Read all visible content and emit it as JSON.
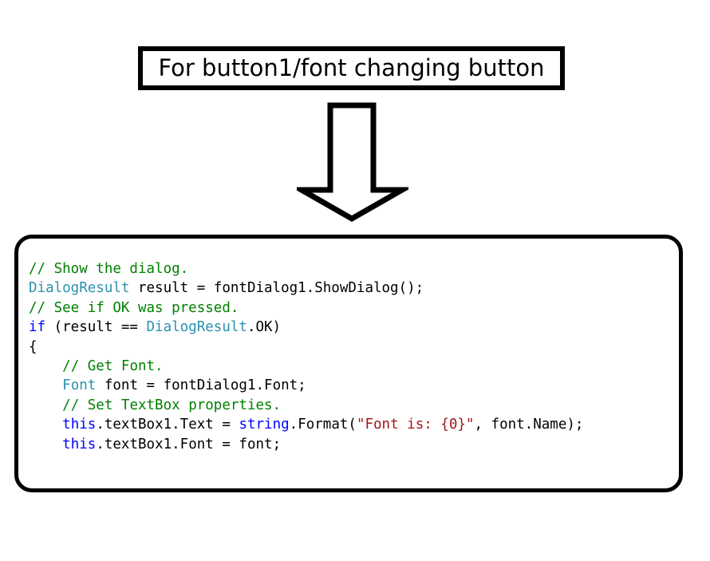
{
  "callout": {
    "title": "For button1/font changing button"
  },
  "arrow": {
    "icon": "down-arrow-icon",
    "direction": "down"
  },
  "code_panel": {
    "language": "csharp",
    "colors": {
      "comment": "#008000",
      "type": "#2B91AF",
      "keyword": "#0000FF",
      "string": "#A31515",
      "plain": "#000000",
      "border": "#000000",
      "background": "#FFFFFF"
    },
    "lines": [
      {
        "index": 0,
        "text": "// Show the dialog.",
        "tokens": [
          {
            "t": "// Show the dialog.",
            "c": "comment"
          }
        ]
      },
      {
        "index": 1,
        "text": "DialogResult result = fontDialog1.ShowDialog();",
        "tokens": [
          {
            "t": "DialogResult",
            "c": "type"
          },
          {
            "t": " result = fontDialog1.ShowDialog();",
            "c": "plain"
          }
        ]
      },
      {
        "index": 2,
        "text": "// See if OK was pressed.",
        "tokens": [
          {
            "t": "// See if OK was pressed.",
            "c": "comment"
          }
        ]
      },
      {
        "index": 3,
        "text": "if (result == DialogResult.OK)",
        "tokens": [
          {
            "t": "if",
            "c": "keyword"
          },
          {
            "t": " (result == ",
            "c": "plain"
          },
          {
            "t": "DialogResult",
            "c": "type"
          },
          {
            "t": ".OK)",
            "c": "plain"
          }
        ]
      },
      {
        "index": 4,
        "text": "{",
        "tokens": [
          {
            "t": "{",
            "c": "plain"
          }
        ]
      },
      {
        "index": 5,
        "text": "    // Get Font.",
        "tokens": [
          {
            "t": "    ",
            "c": "plain"
          },
          {
            "t": "// Get Font.",
            "c": "comment"
          }
        ]
      },
      {
        "index": 6,
        "text": "    Font font = fontDialog1.Font;",
        "tokens": [
          {
            "t": "    ",
            "c": "plain"
          },
          {
            "t": "Font",
            "c": "type"
          },
          {
            "t": " font = fontDialog1.Font;",
            "c": "plain"
          }
        ]
      },
      {
        "index": 7,
        "text": "    // Set TextBox properties.",
        "tokens": [
          {
            "t": "    ",
            "c": "plain"
          },
          {
            "t": "// Set TextBox properties.",
            "c": "comment"
          }
        ]
      },
      {
        "index": 8,
        "text": "    this.textBox1.Text = string.Format(\"Font is: {0}\", font.Name);",
        "tokens": [
          {
            "t": "    ",
            "c": "plain"
          },
          {
            "t": "this",
            "c": "keyword"
          },
          {
            "t": ".textBox1.Text = ",
            "c": "plain"
          },
          {
            "t": "string",
            "c": "keyword"
          },
          {
            "t": ".Format(",
            "c": "plain"
          },
          {
            "t": "\"Font is: {0}\"",
            "c": "string"
          },
          {
            "t": ", font.Name);",
            "c": "plain"
          }
        ]
      },
      {
        "index": 9,
        "text": "    this.textBox1.Font = font;",
        "tokens": [
          {
            "t": "    ",
            "c": "plain"
          },
          {
            "t": "this",
            "c": "keyword"
          },
          {
            "t": ".textBox1.Font = font;",
            "c": "plain"
          }
        ]
      }
    ]
  }
}
